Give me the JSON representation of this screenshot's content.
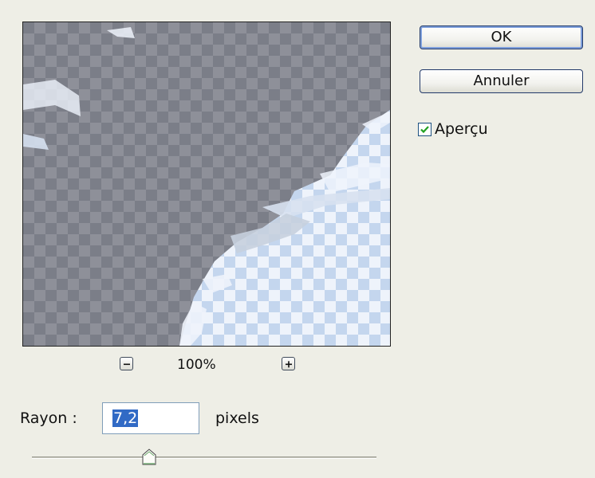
{
  "buttons": {
    "ok_label": "OK",
    "cancel_label": "Annuler"
  },
  "preview_toggle": {
    "label": "Aperçu",
    "checked": true
  },
  "zoom": {
    "level": "100%"
  },
  "radius": {
    "label": "Rayon :",
    "value": "7,2",
    "unit": "pixels",
    "slider_fraction": 0.34
  },
  "icons": {
    "zoom_out": "minus-icon",
    "zoom_in": "plus-icon",
    "check": "checkmark-icon"
  },
  "colors": {
    "default_button_glow": "#7fa0dc",
    "selection": "#316ac5",
    "checkbox_mark": "#21a121"
  }
}
